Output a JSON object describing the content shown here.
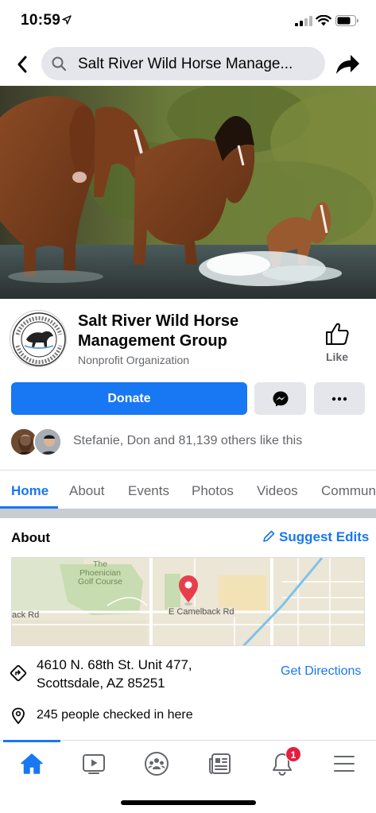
{
  "status_bar": {
    "time": "10:59"
  },
  "nav": {
    "search_value": "Salt River Wild Horse Manage...",
    "back_icon": "chevron-left-icon",
    "share_icon": "share-arrow-icon"
  },
  "page": {
    "name": "Salt River Wild Horse Management Group",
    "category": "Nonprofit Organization",
    "like_label": "Like"
  },
  "actions": {
    "donate_label": "Donate"
  },
  "likers": {
    "text": "Stefanie, Don and 81,139 others like this"
  },
  "tabs": [
    {
      "label": "Home",
      "active": true
    },
    {
      "label": "About"
    },
    {
      "label": "Events"
    },
    {
      "label": "Photos"
    },
    {
      "label": "Videos"
    },
    {
      "label": "Commun"
    }
  ],
  "about": {
    "title": "About",
    "suggest_edits": "Suggest Edits",
    "map": {
      "golf_label_1": "The",
      "golf_label_2": "Phoenician",
      "golf_label_3": "Golf Course",
      "road_label": "E Camelback Rd",
      "road_label_left": "ack Rd"
    },
    "address_line1": "4610 N. 68th St. Unit 477,",
    "address_line2": "Scottsdale, AZ 85251",
    "directions": "Get Directions",
    "checkins": "245 people checked in here"
  },
  "tabbar": {
    "notifications_badge": "1"
  },
  "colors": {
    "accent": "#1877f2",
    "secondary_text": "#65676b",
    "badge": "#e41e3f",
    "button_gray": "#e4e6eb"
  }
}
